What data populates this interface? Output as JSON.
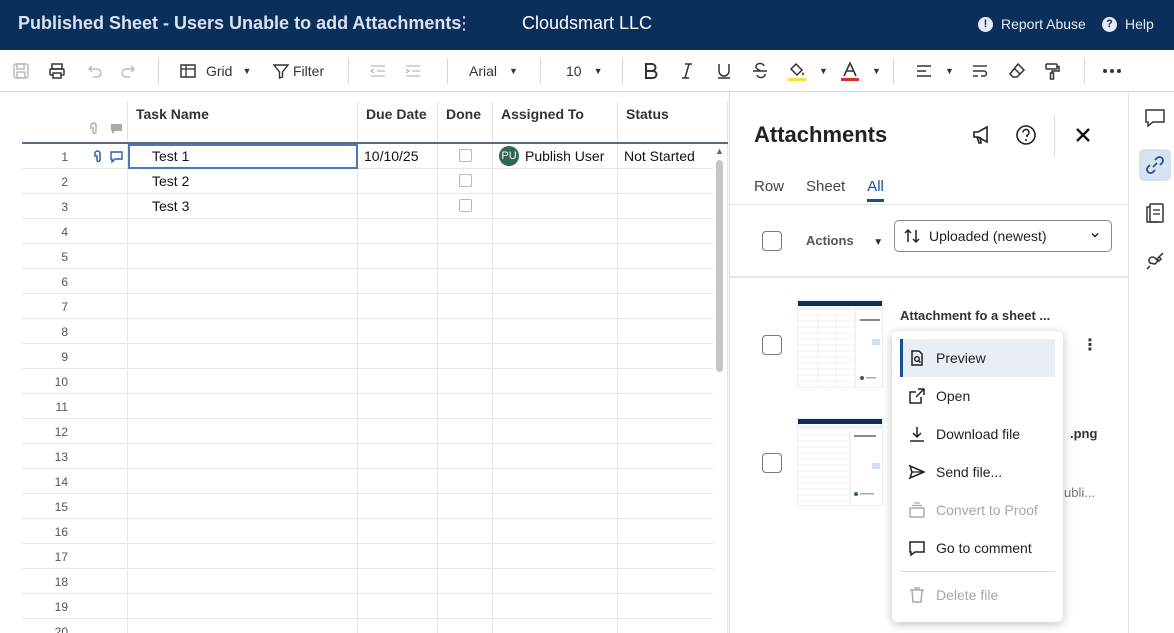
{
  "header": {
    "sheet_title": "Published Sheet - Users Unable to add Attachments",
    "kebab": "⋮",
    "org_name": "Cloudsmart LLC",
    "report_abuse": "Report Abuse",
    "help": "Help"
  },
  "toolbar": {
    "view": "Grid",
    "filter": "Filter",
    "font": "Arial",
    "font_size": "10"
  },
  "grid": {
    "columns": [
      "Task Name",
      "Due Date",
      "Done",
      "Assigned To",
      "Status"
    ],
    "row_numbers": [
      "1",
      "2",
      "3",
      "4",
      "5",
      "6",
      "7",
      "8",
      "9",
      "10",
      "11",
      "12",
      "13",
      "14",
      "15",
      "16",
      "17",
      "18",
      "19",
      "20"
    ],
    "rows": [
      {
        "task": "Test 1",
        "due": "10/10/25",
        "assigned_initials": "PU",
        "assigned": "Publish User",
        "status": "Not Started"
      },
      {
        "task": "Test 2",
        "due": "",
        "assigned": "",
        "status": ""
      },
      {
        "task": "Test 3",
        "due": "",
        "assigned": "",
        "status": ""
      }
    ]
  },
  "panel": {
    "title": "Attachments",
    "tabs": [
      "Row",
      "Sheet",
      "All"
    ],
    "active_tab": "All",
    "actions": "Actions",
    "sort": "Uploaded (newest)",
    "attachments": [
      {
        "name": "Attachment fo a sheet ..."
      },
      {
        "name_tail": ".png",
        "sub_tail": "ubli..."
      }
    ]
  },
  "menu": {
    "items": [
      "Preview",
      "Open",
      "Download file",
      "Send file...",
      "Convert to Proof",
      "Go to comment",
      "Delete file"
    ]
  },
  "colors": {
    "header_bg": "#0b2f5b",
    "accent": "#1a4f9a",
    "avatar": "#2f6655"
  }
}
